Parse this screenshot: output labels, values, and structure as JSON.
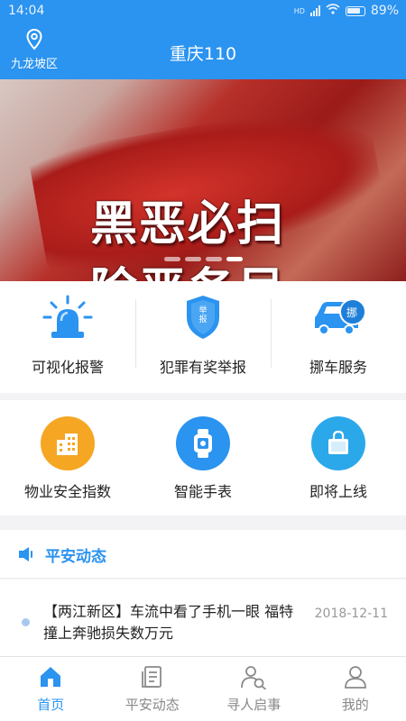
{
  "status_bar": {
    "time": "14:04",
    "network": "HD",
    "battery": "89%"
  },
  "header": {
    "location_icon": "location-pin-icon",
    "location": "九龙坡区",
    "title": "重庆110"
  },
  "banner": {
    "line1": "黑恶必扫",
    "line2": "除恶务尽",
    "slide_count": 4,
    "active_slide": 4
  },
  "services_row1": [
    {
      "label": "可视化报警",
      "icon": "alarm-siren-icon"
    },
    {
      "label": "犯罪有奖举报",
      "icon": "report-badge-icon",
      "badge_text": "举报"
    },
    {
      "label": "挪车服务",
      "icon": "move-car-icon",
      "badge_text": "挪"
    }
  ],
  "services_row2": [
    {
      "label": "物业安全指数",
      "icon": "building-icon",
      "color": "#f5a623"
    },
    {
      "label": "智能手表",
      "icon": "smart-watch-icon",
      "color": "#2b93f0"
    },
    {
      "label": "即将上线",
      "icon": "shopping-bag-icon",
      "color": "#2ba8ea"
    }
  ],
  "news_section": {
    "title": "平安动态",
    "icon": "speaker-icon"
  },
  "news_items": [
    {
      "text": "【两江新区】车流中看了手机一眼 福特撞上奔驰损失数万元",
      "date": "2018-12-11"
    }
  ],
  "tabs": [
    {
      "label": "首页",
      "icon": "home-icon",
      "active": true
    },
    {
      "label": "平安动态",
      "icon": "news-icon",
      "active": false
    },
    {
      "label": "寻人启事",
      "icon": "search-person-icon",
      "active": false
    },
    {
      "label": "我的",
      "icon": "user-icon",
      "active": false
    }
  ],
  "colors": {
    "primary": "#2b93f0",
    "background": "#f3f3f5",
    "banner_red": "#b7302a"
  }
}
